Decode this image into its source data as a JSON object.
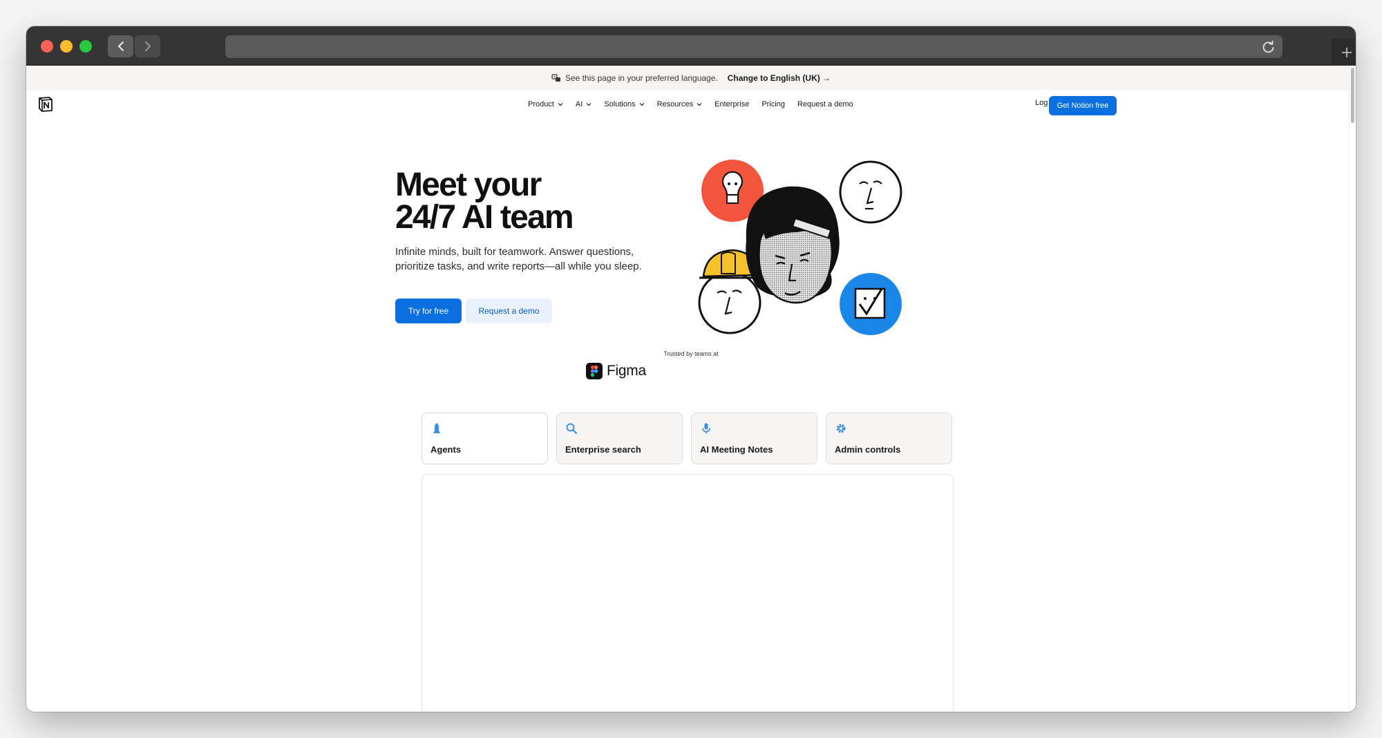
{
  "language_banner": {
    "text": "See this page in your preferred language.",
    "link": "Change to English (UK) →"
  },
  "nav": {
    "items": [
      {
        "label": "Product",
        "dropdown": true
      },
      {
        "label": "AI",
        "dropdown": true
      },
      {
        "label": "Solutions",
        "dropdown": true
      },
      {
        "label": "Resources",
        "dropdown": true
      },
      {
        "label": "Enterprise",
        "dropdown": false
      },
      {
        "label": "Pricing",
        "dropdown": false
      },
      {
        "label": "Request a demo",
        "dropdown": false
      }
    ],
    "login": "Log in",
    "cta": "Get Notion free"
  },
  "hero": {
    "title_line1": "Meet your",
    "title_line2": "24/7 AI team",
    "subtitle": "Infinite minds, built for teamwork. Answer questions, prioritize tasks, and write reports—all while you sleep.",
    "primary_button": "Try for free",
    "secondary_button": "Request a demo"
  },
  "trusted": {
    "label": "Trusted by teams at",
    "company": "Figma"
  },
  "feature_tabs": [
    {
      "label": "Agents",
      "icon": "agent-icon",
      "active": true
    },
    {
      "label": "Enterprise search",
      "icon": "search-icon",
      "active": false
    },
    {
      "label": "AI Meeting Notes",
      "icon": "microphone-icon",
      "active": false
    },
    {
      "label": "Admin controls",
      "icon": "gear-icon",
      "active": false
    }
  ],
  "colors": {
    "accent": "#0b6fe0",
    "accent_soft": "#e8f1fc",
    "illustration_red": "#f2553c",
    "illustration_blue": "#1a86e8",
    "illustration_yellow": "#f6c22b"
  }
}
